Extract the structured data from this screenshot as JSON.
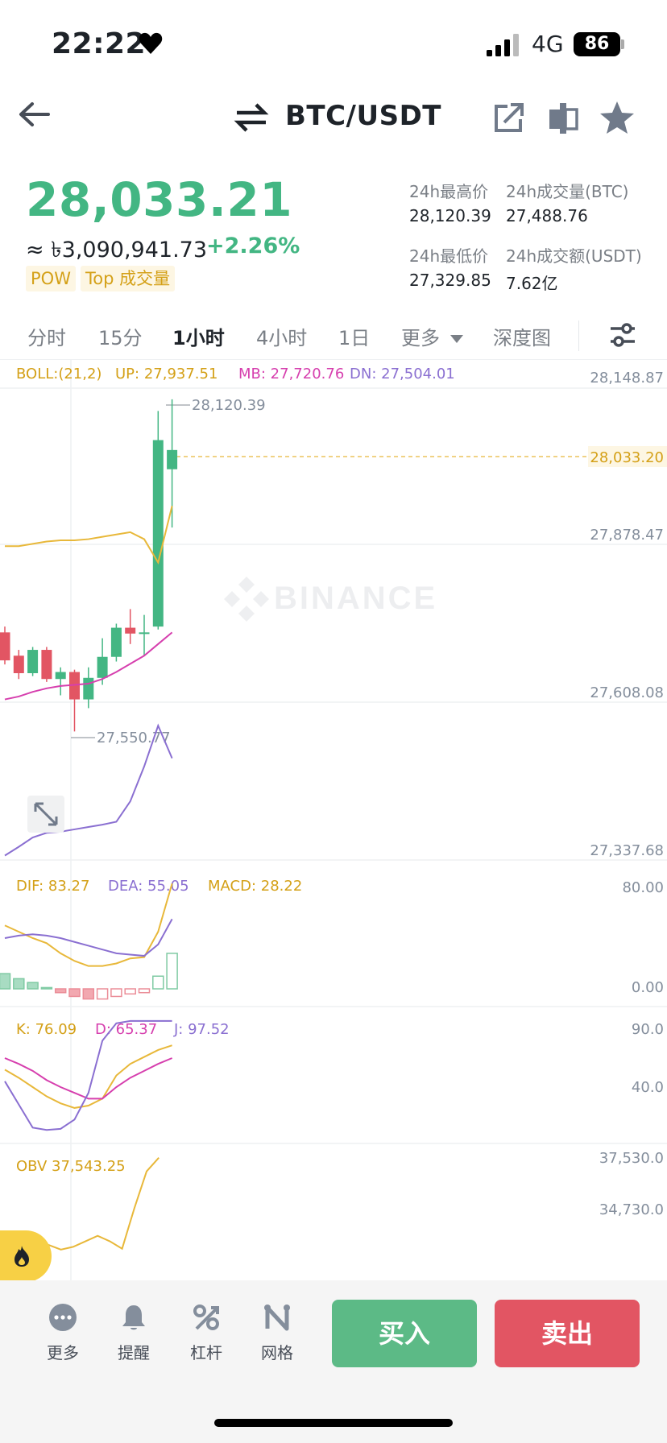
{
  "status_bar": {
    "time": "22:22",
    "network": "4G",
    "battery": "86"
  },
  "header": {
    "pair": "BTC/USDT"
  },
  "price": {
    "last": "28,033.21",
    "fiat": "≈ ৳3,090,941.73",
    "change_pct": "+2.26%",
    "tags": [
      "POW",
      "Top 成交量"
    ]
  },
  "stats": {
    "high_label": "24h最高价",
    "high_value": "28,120.39",
    "vol_btc_label": "24h成交量(BTC)",
    "vol_btc_value": "27,488.76",
    "low_label": "24h最低价",
    "low_value": "27,329.85",
    "vol_usdt_label": "24h成交额(USDT)",
    "vol_usdt_value": "7.62亿"
  },
  "tabs": [
    "分时",
    "15分",
    "1小时",
    "4小时",
    "1日",
    "更多",
    "深度图"
  ],
  "active_tab": "1小时",
  "colors": {
    "up": "#43b683",
    "down": "#e25563",
    "boll_up": "#e8b83a",
    "boll_mb": "#d63fae",
    "boll_dn": "#8a6fd1"
  },
  "chart_data": {
    "type": "candlestick",
    "watermark": "BINANCE",
    "main": {
      "legend": {
        "boll": "BOLL:(21,2)",
        "up": "UP: 27,937.51",
        "mb": "MB: 27,720.76",
        "dn": "DN: 27,504.01"
      },
      "y_ticks": [
        "28,148.87",
        "27,878.47",
        "27,608.08",
        "27,337.68"
      ],
      "y_range": [
        27337.68,
        28148.87
      ],
      "current_price_label": "28,033.20",
      "current_price": 28033.2,
      "high_marker": "28,120.39",
      "low_marker": "27,550.77",
      "candles": [
        {
          "o": 27720,
          "h": 27730,
          "l": 27665,
          "c": 27672
        },
        {
          "o": 27680,
          "h": 27690,
          "l": 27640,
          "c": 27650
        },
        {
          "o": 27650,
          "h": 27695,
          "l": 27645,
          "c": 27690
        },
        {
          "o": 27690,
          "h": 27695,
          "l": 27635,
          "c": 27640
        },
        {
          "o": 27640,
          "h": 27660,
          "l": 27612,
          "c": 27652
        },
        {
          "o": 27652,
          "h": 27656,
          "l": 27550,
          "c": 27605
        },
        {
          "o": 27605,
          "h": 27660,
          "l": 27590,
          "c": 27642
        },
        {
          "o": 27642,
          "h": 27710,
          "l": 27630,
          "c": 27678
        },
        {
          "o": 27678,
          "h": 27735,
          "l": 27670,
          "c": 27728
        },
        {
          "o": 27728,
          "h": 27760,
          "l": 27700,
          "c": 27718
        },
        {
          "o": 27718,
          "h": 27750,
          "l": 27680,
          "c": 27720
        },
        {
          "o": 27730,
          "h": 28100,
          "l": 27725,
          "c": 28050
        },
        {
          "o": 28000,
          "h": 28120,
          "l": 27900,
          "c": 28033
        }
      ],
      "boll_up": [
        27868,
        27868,
        27872,
        27876,
        27878,
        27878,
        27880,
        27884,
        27888,
        27892,
        27880,
        27840,
        27937
      ],
      "boll_mb": [
        27605,
        27610,
        27618,
        27624,
        27628,
        27630,
        27632,
        27640,
        27652,
        27666,
        27680,
        27700,
        27720
      ],
      "boll_dn": [
        27337,
        27352,
        27368,
        27376,
        27378,
        27382,
        27386,
        27390,
        27395,
        27430,
        27490,
        27560,
        27504
      ]
    },
    "macd": {
      "legend": {
        "dif": "DIF: 83.27",
        "dea": "DEA: 55.05",
        "macd": "MACD: 28.22"
      },
      "y_ticks": [
        "80.00",
        "0.00"
      ],
      "y_range": [
        0,
        80
      ],
      "dif": [
        50,
        45,
        40,
        36,
        28,
        22,
        18,
        18,
        20,
        24,
        25,
        45,
        83
      ],
      "dea": [
        40,
        42,
        43,
        42,
        40,
        37,
        34,
        31,
        28,
        27,
        26,
        35,
        55
      ],
      "hist": [
        12,
        8,
        5,
        1,
        -3,
        -6,
        -8,
        -8,
        -6,
        -4,
        -3,
        10,
        28
      ]
    },
    "kdj": {
      "legend": {
        "k": "K: 76.09",
        "d": "D: 65.37",
        "j": "J: 97.52"
      },
      "y_ticks": [
        "90.0",
        "40.0"
      ],
      "y_range": [
        0,
        100
      ],
      "k": [
        55,
        48,
        40,
        32,
        26,
        22,
        24,
        30,
        50,
        60,
        66,
        72,
        76
      ],
      "d": [
        65,
        60,
        54,
        46,
        40,
        35,
        30,
        30,
        40,
        48,
        54,
        60,
        65
      ],
      "j": [
        45,
        25,
        5,
        3,
        4,
        12,
        35,
        80,
        95,
        97,
        97,
        97,
        97
      ]
    },
    "obv": {
      "legend": "OBV 37,543.25",
      "y_ticks": [
        "37,530.0",
        "34,730.0"
      ],
      "y_range": [
        32500,
        37700
      ],
      "values": [
        32900,
        33100,
        32800,
        32550,
        32700,
        33000,
        33300,
        33000,
        32600,
        34800,
        36800,
        37543
      ]
    }
  },
  "bottom_bar": {
    "items": [
      "更多",
      "提醒",
      "杠杆",
      "网格"
    ],
    "buy": "买入",
    "sell": "卖出"
  }
}
